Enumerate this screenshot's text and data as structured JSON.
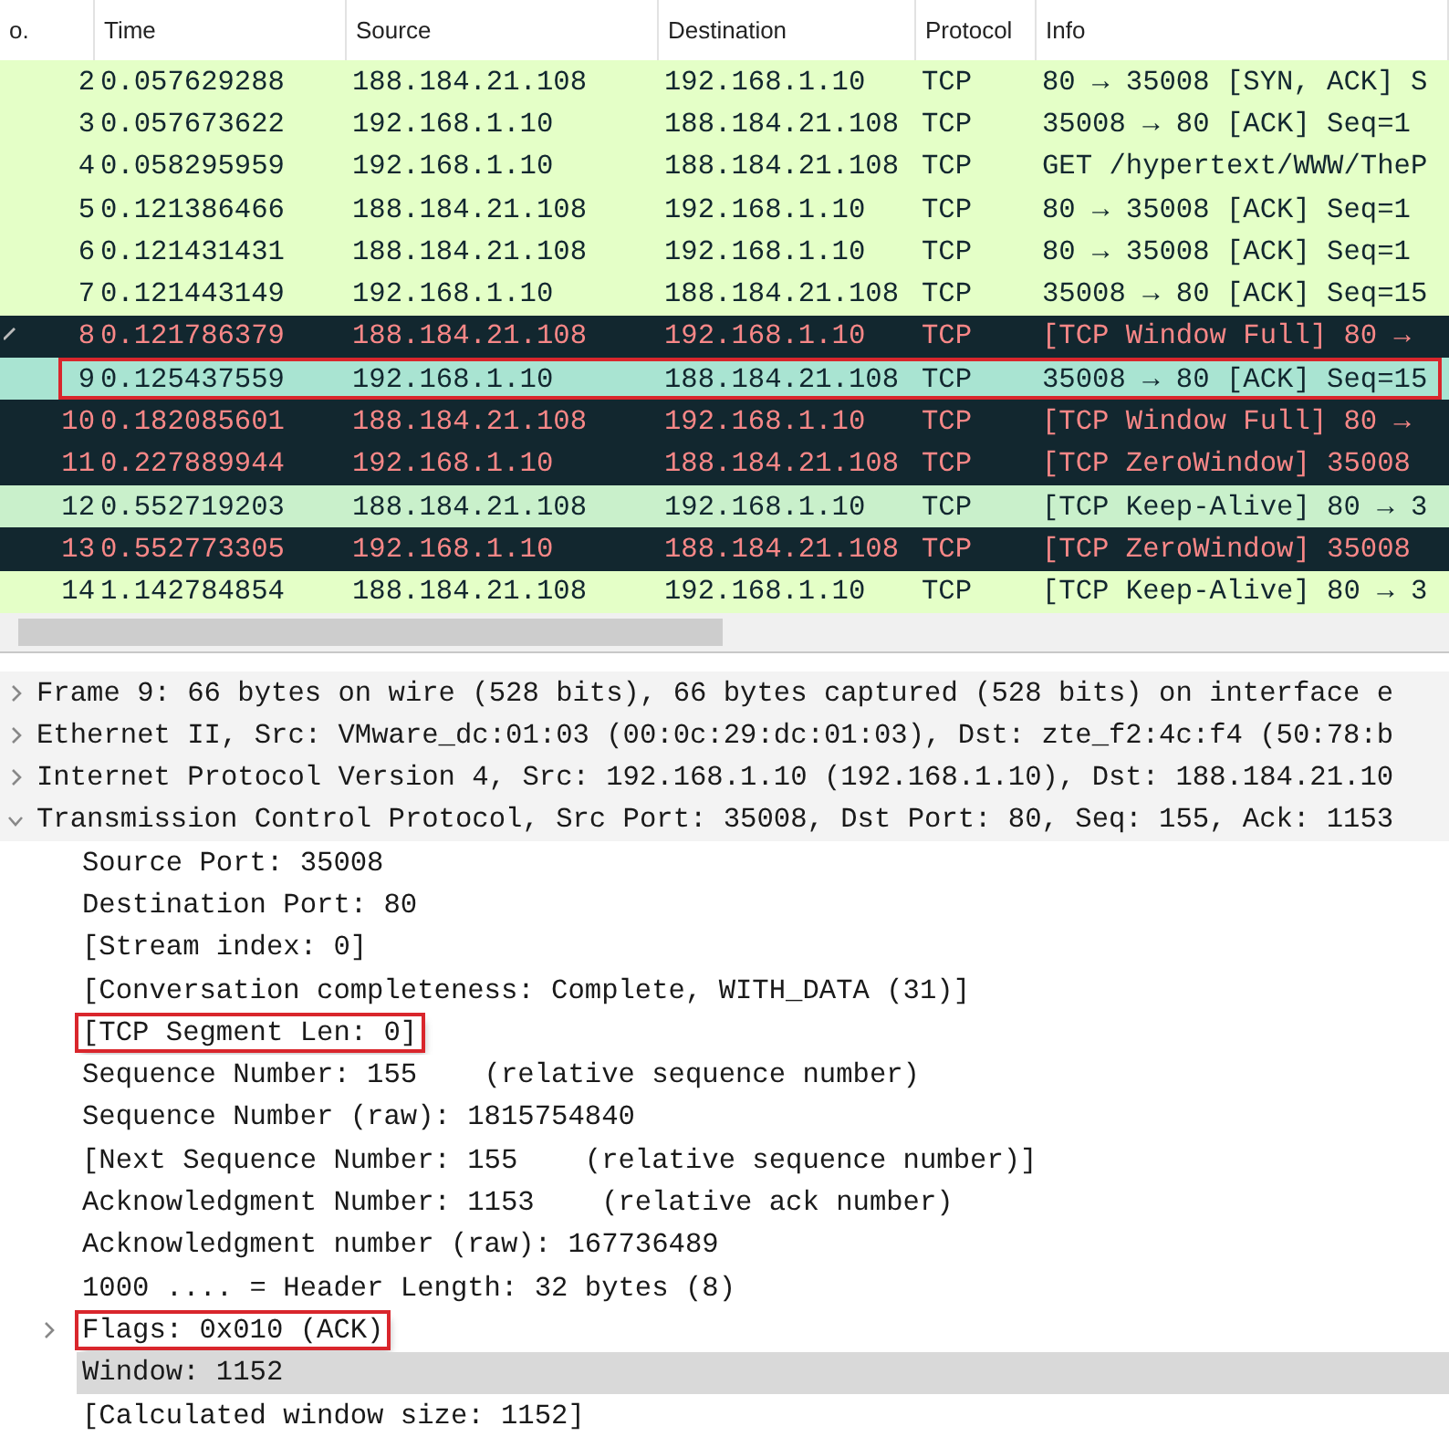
{
  "packet_list": {
    "columns": [
      "o.",
      "Time",
      "Source",
      "Destination",
      "Protocol",
      "Info"
    ],
    "rows": [
      {
        "no": "2",
        "time": "0.057629288",
        "source": "188.184.21.108",
        "destination": "192.168.1.10",
        "protocol": "TCP",
        "info": "80 → 35008 [SYN, ACK] S",
        "kind": "normal",
        "selected": false,
        "highlighted": false,
        "related": false
      },
      {
        "no": "3",
        "time": "0.057673622",
        "source": "192.168.1.10",
        "destination": "188.184.21.108",
        "protocol": "TCP",
        "info": "35008 → 80 [ACK] Seq=1",
        "kind": "normal",
        "selected": false,
        "highlighted": false,
        "related": false
      },
      {
        "no": "4",
        "time": "0.058295959",
        "source": "192.168.1.10",
        "destination": "188.184.21.108",
        "protocol": "TCP",
        "info": "GET /hypertext/WWW/TheP",
        "kind": "normal",
        "selected": false,
        "highlighted": false,
        "related": false
      },
      {
        "no": "5",
        "time": "0.121386466",
        "source": "188.184.21.108",
        "destination": "192.168.1.10",
        "protocol": "TCP",
        "info": "80 → 35008 [ACK] Seq=1",
        "kind": "normal",
        "selected": false,
        "highlighted": false,
        "related": false
      },
      {
        "no": "6",
        "time": "0.121431431",
        "source": "188.184.21.108",
        "destination": "192.168.1.10",
        "protocol": "TCP",
        "info": "80 → 35008 [ACK] Seq=1",
        "kind": "normal",
        "selected": false,
        "highlighted": false,
        "related": false
      },
      {
        "no": "7",
        "time": "0.121443149",
        "source": "192.168.1.10",
        "destination": "188.184.21.108",
        "protocol": "TCP",
        "info": "35008 → 80 [ACK] Seq=15",
        "kind": "normal",
        "selected": false,
        "highlighted": false,
        "related": false
      },
      {
        "no": "8",
        "time": "0.121786379",
        "source": "188.184.21.108",
        "destination": "192.168.1.10",
        "protocol": "TCP",
        "info": "[TCP Window Full] 80 →",
        "kind": "error",
        "selected": false,
        "highlighted": false,
        "related": true
      },
      {
        "no": "9",
        "time": "0.125437559",
        "source": "192.168.1.10",
        "destination": "188.184.21.108",
        "protocol": "TCP",
        "info": "35008 → 80 [ACK] Seq=15",
        "kind": "normal",
        "selected": true,
        "highlighted": true,
        "related": false
      },
      {
        "no": "10",
        "time": "0.182085601",
        "source": "188.184.21.108",
        "destination": "192.168.1.10",
        "protocol": "TCP",
        "info": "[TCP Window Full] 80 →",
        "kind": "error",
        "selected": false,
        "highlighted": false,
        "related": false
      },
      {
        "no": "11",
        "time": "0.227889944",
        "source": "192.168.1.10",
        "destination": "188.184.21.108",
        "protocol": "TCP",
        "info": "[TCP ZeroWindow] 35008",
        "kind": "error",
        "selected": false,
        "highlighted": false,
        "related": false
      },
      {
        "no": "12",
        "time": "0.552719203",
        "source": "188.184.21.108",
        "destination": "192.168.1.10",
        "protocol": "TCP",
        "info": "[TCP Keep-Alive] 80 → 3",
        "kind": "keepalive",
        "selected": false,
        "highlighted": false,
        "related": false
      },
      {
        "no": "13",
        "time": "0.552773305",
        "source": "192.168.1.10",
        "destination": "188.184.21.108",
        "protocol": "TCP",
        "info": "[TCP ZeroWindow] 35008",
        "kind": "error",
        "selected": false,
        "highlighted": false,
        "related": false
      },
      {
        "no": "14",
        "time": "1.142784854",
        "source": "188.184.21.108",
        "destination": "192.168.1.10",
        "protocol": "TCP",
        "info": "[TCP Keep-Alive] 80 → 3",
        "kind": "normal",
        "selected": false,
        "highlighted": false,
        "related": false
      }
    ]
  },
  "packet_details": [
    {
      "text": "Frame 9: 66 bytes on wire (528 bits), 66 bytes captured (528 bits) on interface e",
      "expanded": false,
      "selected": false,
      "highlighted": false
    },
    {
      "text": "Ethernet II, Src: VMware_dc:01:03 (00:0c:29:dc:01:03), Dst: zte_f2:4c:f4 (50:78:b",
      "expanded": false,
      "selected": false,
      "highlighted": false
    },
    {
      "text": "Internet Protocol Version 4, Src: 192.168.1.10 (192.168.1.10), Dst: 188.184.21.10",
      "expanded": false,
      "selected": false,
      "highlighted": false
    },
    {
      "text": "Transmission Control Protocol, Src Port: 35008, Dst Port: 80, Seq: 155, Ack: 1153",
      "expanded": true,
      "selected": false,
      "highlighted": false,
      "children": [
        {
          "text": "Source Port: 35008",
          "selected": false,
          "highlighted": false
        },
        {
          "text": "Destination Port: 80",
          "selected": false,
          "highlighted": false
        },
        {
          "text": "[Stream index: 0]",
          "selected": false,
          "highlighted": false
        },
        {
          "text": "[Conversation completeness: Complete, WITH_DATA (31)]",
          "selected": false,
          "highlighted": false
        },
        {
          "text": "[TCP Segment Len: 0]",
          "selected": false,
          "highlighted": true
        },
        {
          "text": "Sequence Number: 155    (relative sequence number)",
          "selected": false,
          "highlighted": false
        },
        {
          "text": "Sequence Number (raw): 1815754840",
          "selected": false,
          "highlighted": false
        },
        {
          "text": "[Next Sequence Number: 155    (relative sequence number)]",
          "selected": false,
          "highlighted": false
        },
        {
          "text": "Acknowledgment Number: 1153    (relative ack number)",
          "selected": false,
          "highlighted": false
        },
        {
          "text": "Acknowledgment number (raw): 167736489",
          "selected": false,
          "highlighted": false
        },
        {
          "text": "1000 .... = Header Length: 32 bytes (8)",
          "selected": false,
          "highlighted": false
        },
        {
          "text": "Flags: 0x010 (ACK)",
          "expanded": false,
          "selected": false,
          "highlighted": true
        },
        {
          "text": "Window: 1152",
          "selected": true,
          "highlighted": false
        },
        {
          "text": "[Calculated window size: 1152]",
          "selected": false,
          "highlighted": false
        }
      ]
    }
  ]
}
